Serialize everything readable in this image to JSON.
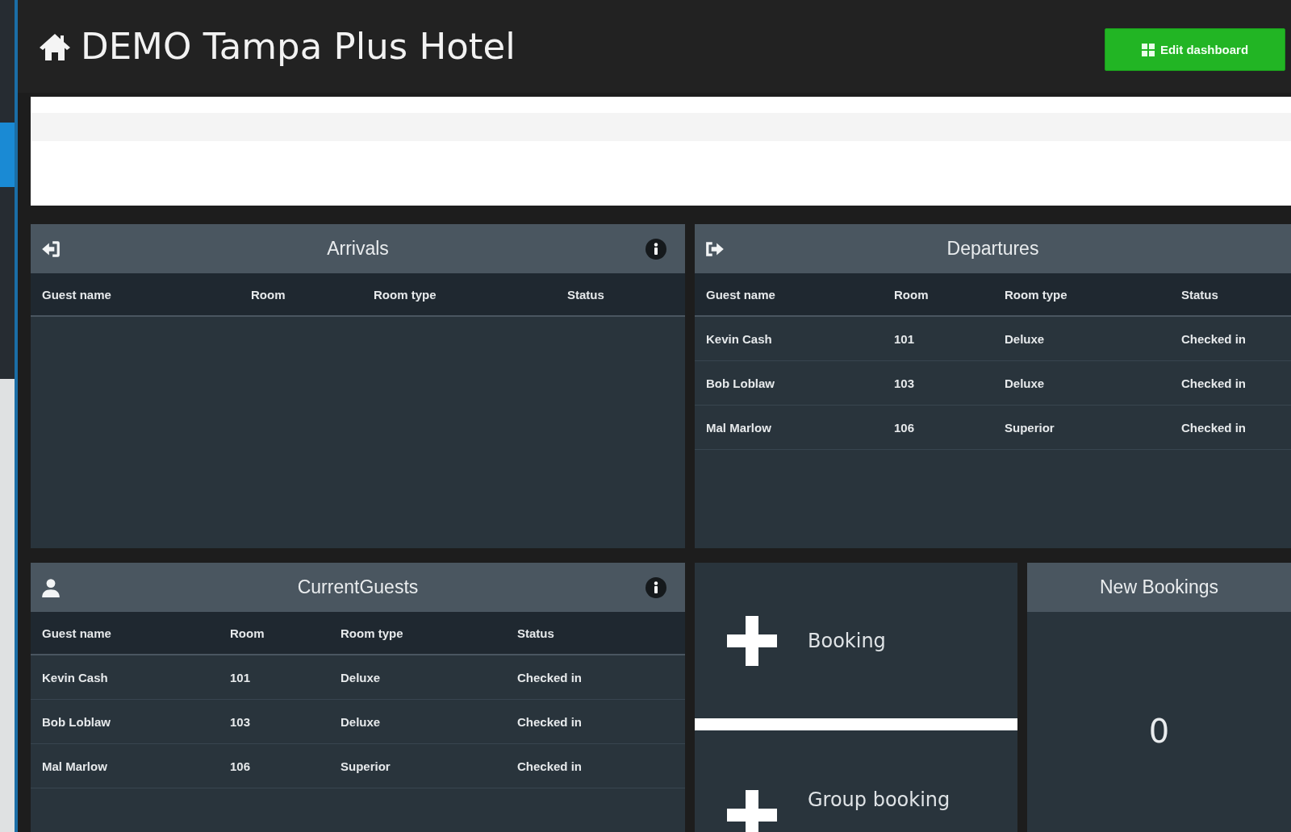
{
  "sidebar": {
    "items": [
      {
        "selected": false
      },
      {
        "selected": true
      },
      {
        "selected": false
      }
    ]
  },
  "header": {
    "title": "DEMO Tampa Plus Hotel",
    "button": "Edit dashboard"
  },
  "panels": [
    {
      "title": "Arrivals",
      "info": true,
      "columns": [
        "Guest name",
        "Room",
        "Room type",
        "Status"
      ]
    },
    {
      "title": "Departures",
      "columns": [
        "Guest name",
        "Room",
        "Room type",
        "Status"
      ],
      "rows": [
        [
          "Kevin Cash",
          "101",
          "Deluxe",
          "Checked in"
        ],
        [
          "Bob Loblaw",
          "103",
          "Deluxe",
          "Checked in"
        ],
        [
          "Mal Marlow",
          "106",
          "Superior",
          "Checked in"
        ]
      ]
    },
    {
      "title": "CurrentGuests",
      "info": true,
      "columns": [
        "Guest name",
        "Room",
        "Room type",
        "Status"
      ],
      "rows": [
        [
          "Kevin Cash",
          "101",
          "Deluxe",
          "Checked in"
        ],
        [
          "Bob Loblaw",
          "103",
          "Deluxe",
          "Checked in"
        ],
        [
          "Mal Marlow",
          "106",
          "Superior",
          "Checked in"
        ]
      ]
    }
  ],
  "booking_actions": [
    {
      "label": "Booking"
    },
    {
      "label": "Group booking"
    }
  ],
  "new_bookings": {
    "title": "New Bookings",
    "count": "0"
  }
}
